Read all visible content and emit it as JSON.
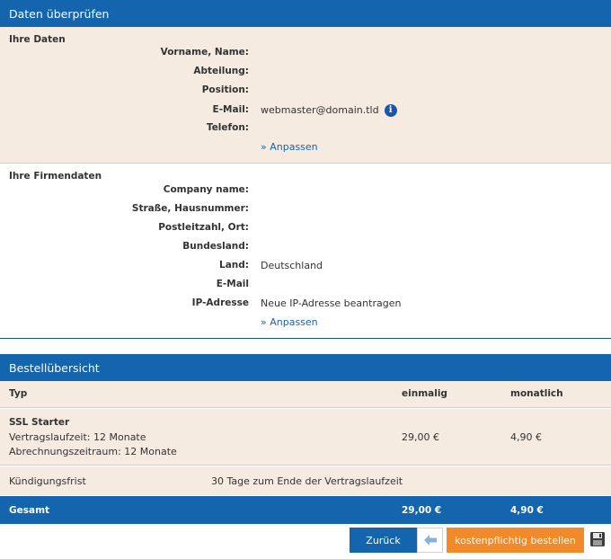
{
  "header": {
    "title": "Daten überprüfen"
  },
  "personal": {
    "title": "Ihre Daten",
    "fields": [
      {
        "label": "Vorname, Name:",
        "value": ""
      },
      {
        "label": "Abteilung:",
        "value": ""
      },
      {
        "label": "Position:",
        "value": ""
      },
      {
        "label": "E-Mail:",
        "value": "webmaster@domain.tld"
      },
      {
        "label": "Telefon:",
        "value": ""
      }
    ],
    "link": "» Anpassen"
  },
  "company": {
    "title": "Ihre Firmendaten",
    "fields": [
      {
        "label": "Company name:",
        "value": ""
      },
      {
        "label": "Straße, Hausnummer:",
        "value": ""
      },
      {
        "label": "Postleitzahl, Ort:",
        "value": ""
      },
      {
        "label": "Bundesland:",
        "value": ""
      },
      {
        "label": "Land:",
        "value": "Deutschland"
      },
      {
        "label": "E-Mail",
        "value": ""
      },
      {
        "label": "IP-Adresse",
        "value": "Neue IP-Adresse beantragen"
      }
    ],
    "link": "» Anpassen"
  },
  "order": {
    "title": "Bestellübersicht",
    "columns": {
      "type": "Typ",
      "once": "einmalig",
      "monthly": "monatlich"
    },
    "product": {
      "name": "SSL Starter",
      "line1": "Vertragslaufzeit: 12 Monate",
      "line2": "Abrechnungszeitraum: 12 Monate",
      "once": "29,00 €",
      "monthly": "4,90 €"
    },
    "cancellation": {
      "label": "Kündigungsfrist",
      "value": "30 Tage zum Ende der Vertragslaufzeit"
    },
    "total": {
      "label": "Gesamt",
      "once": "29,00 €",
      "monthly": "4,90 €"
    }
  },
  "actions": {
    "back": "Zurück",
    "order": "kostenpflichtig bestellen"
  },
  "colors": {
    "primary": "#1464ae",
    "accent": "#f18a2a",
    "panel": "#f6ebe0"
  }
}
